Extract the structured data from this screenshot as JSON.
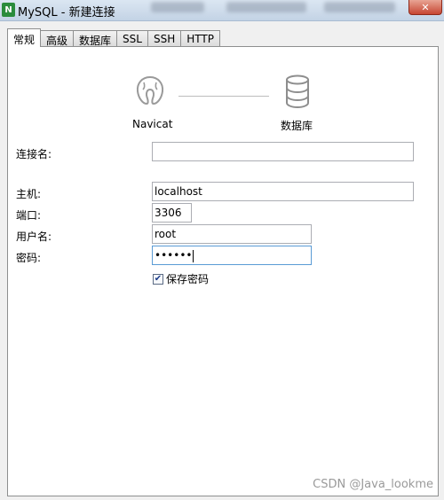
{
  "window": {
    "title": "MySQL - 新建连接",
    "close_label": "✕"
  },
  "tabs": [
    {
      "label": "常规",
      "active": true
    },
    {
      "label": "高级",
      "active": false
    },
    {
      "label": "数据库",
      "active": false
    },
    {
      "label": "SSL",
      "active": false
    },
    {
      "label": "SSH",
      "active": false
    },
    {
      "label": "HTTP",
      "active": false
    }
  ],
  "header": {
    "navicat_label": "Navicat",
    "database_label": "数据库"
  },
  "form": {
    "connection_name_label": "连接名:",
    "connection_name_value": "",
    "host_label": "主机:",
    "host_value": "localhost",
    "port_label": "端口:",
    "port_value": "3306",
    "username_label": "用户名:",
    "username_value": "root",
    "password_label": "密码:",
    "password_value": "••••••",
    "save_password_label": "保存密码",
    "save_password_checked": true
  },
  "watermark": "CSDN @Java_lookme",
  "colors": {
    "focus_border": "#5a9bd5",
    "app_icon": "#2a8c3c"
  }
}
